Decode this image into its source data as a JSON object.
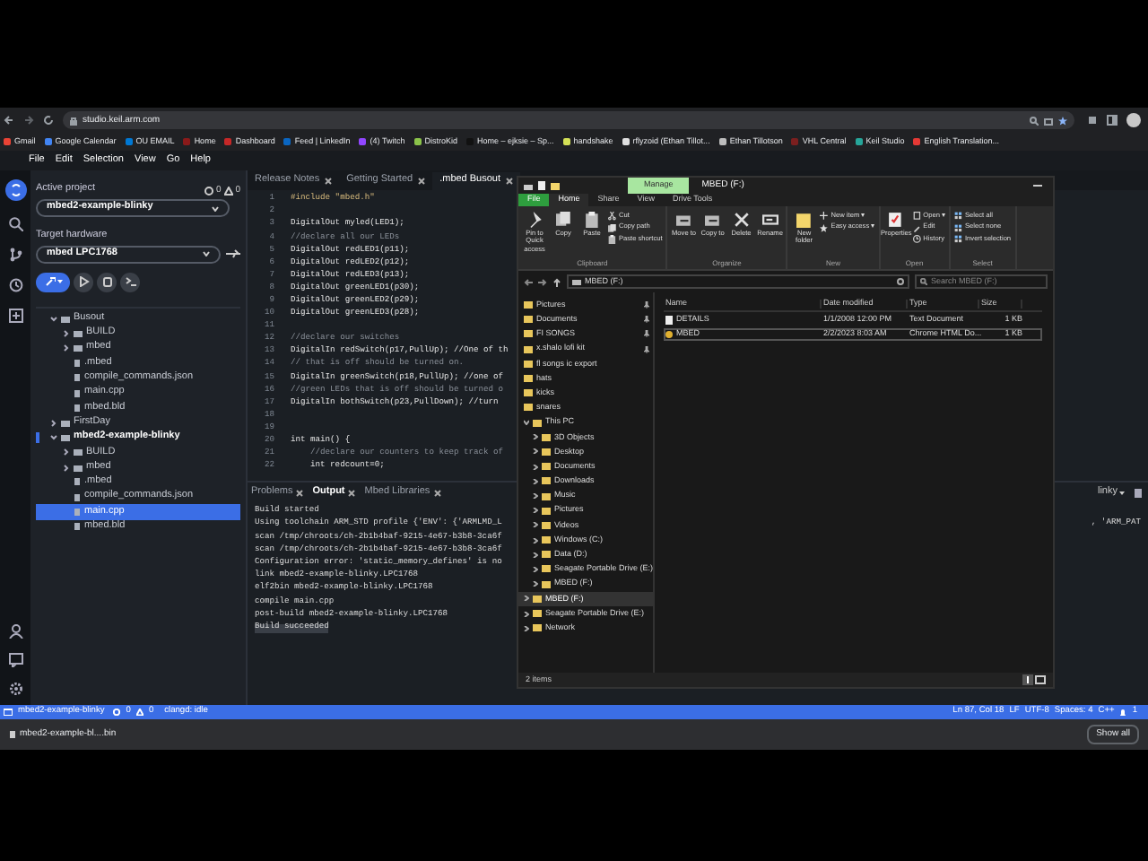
{
  "browser": {
    "url": "studio.keil.arm.com",
    "bookmarks": [
      {
        "label": "Gmail",
        "color": "#ea4335"
      },
      {
        "label": "Google Calendar",
        "color": "#4285f4"
      },
      {
        "label": "OU EMAIL",
        "color": "#0078d4"
      },
      {
        "label": "Home",
        "color": "#8b1a1a"
      },
      {
        "label": "Dashboard",
        "color": "#c62828"
      },
      {
        "label": "Feed | LinkedIn",
        "color": "#0a66c2"
      },
      {
        "label": "(4) Twitch",
        "color": "#9146ff"
      },
      {
        "label": "DistroKid",
        "color": "#8bc34a"
      },
      {
        "label": "Home – ejksie – Sp...",
        "color": "#111111"
      },
      {
        "label": "handshake",
        "color": "#d4e157"
      },
      {
        "label": "rflyzoid (Ethan Tillot...",
        "color": "#e0e0e0"
      },
      {
        "label": "Ethan Tillotson",
        "color": "#bdbdbd"
      },
      {
        "label": "VHL Central",
        "color": "#7b1f1f"
      },
      {
        "label": "Keil Studio",
        "color": "#26a69a"
      },
      {
        "label": "English Translation...",
        "color": "#e53935"
      }
    ]
  },
  "menu": [
    "File",
    "Edit",
    "Selection",
    "View",
    "Go",
    "Help"
  ],
  "sidebar": {
    "active_project_label": "Active project",
    "errors": "0",
    "warnings": "0",
    "active_project": "mbed2-example-blinky",
    "target_label": "Target hardware",
    "target": "mbed LPC1768",
    "tree": [
      {
        "label": "Busout",
        "kind": "folder",
        "expanded": true,
        "active": false,
        "selected": false,
        "children": [
          {
            "label": "BUILD",
            "kind": "folder",
            "expanded": false,
            "selected": false
          },
          {
            "label": "mbed",
            "kind": "folder",
            "expanded": false,
            "selected": false
          },
          {
            "label": ".mbed",
            "kind": "file",
            "selected": false
          },
          {
            "label": "compile_commands.json",
            "kind": "file",
            "selected": false
          },
          {
            "label": "main.cpp",
            "kind": "file",
            "selected": false
          },
          {
            "label": "mbed.bld",
            "kind": "file",
            "selected": false
          }
        ]
      },
      {
        "label": "FirstDay",
        "kind": "folder",
        "expanded": false,
        "active": false,
        "selected": false
      },
      {
        "label": "mbed2-example-blinky",
        "kind": "folder",
        "expanded": true,
        "active": true,
        "selected": false,
        "children": [
          {
            "label": "BUILD",
            "kind": "folder",
            "expanded": false,
            "selected": false
          },
          {
            "label": "mbed",
            "kind": "folder",
            "expanded": false,
            "selected": false
          },
          {
            "label": ".mbed",
            "kind": "file",
            "selected": false
          },
          {
            "label": "compile_commands.json",
            "kind": "file",
            "selected": false
          },
          {
            "label": "main.cpp",
            "kind": "file",
            "selected": true
          },
          {
            "label": "mbed.bld",
            "kind": "file",
            "selected": false
          }
        ]
      }
    ]
  },
  "editor": {
    "tabs": [
      {
        "label": "Release Notes",
        "selected": false
      },
      {
        "label": "Getting Started",
        "selected": false
      },
      {
        "label": ".mbed Busout",
        "selected": true
      }
    ],
    "lines": [
      {
        "number": "1",
        "kind": "include",
        "text": "#include \"mbed.h\""
      },
      {
        "number": "2"
      },
      {
        "number": "3",
        "kind": "code",
        "text": "DigitalOut myled(LED1);"
      },
      {
        "number": "4",
        "kind": "comment",
        "text": "//declare all our LEDs"
      },
      {
        "number": "5",
        "kind": "code",
        "text": "DigitalOut redLED1(p11);"
      },
      {
        "number": "6",
        "kind": "code",
        "text": "DigitalOut redLED2(p12);"
      },
      {
        "number": "7",
        "kind": "code",
        "text": "DigitalOut redLED3(p13);"
      },
      {
        "number": "8",
        "kind": "code",
        "text": "DigitalOut greenLED1(p30);"
      },
      {
        "number": "9",
        "kind": "code",
        "text": "DigitalOut greenLED2(p29);"
      },
      {
        "number": "10",
        "kind": "code",
        "text": "DigitalOut greenLED3(p28);"
      },
      {
        "number": "11"
      },
      {
        "number": "12",
        "kind": "comment",
        "text": "//declare our switches"
      },
      {
        "number": "13",
        "kind": "code",
        "text": "DigitalIn redSwitch(p17,PullUp); //One of th"
      },
      {
        "number": "14",
        "kind": "comment",
        "text": "// that is off should be turned on."
      },
      {
        "number": "15",
        "kind": "code",
        "text": "DigitalIn greenSwitch(p18,PullUp); //one of"
      },
      {
        "number": "16",
        "kind": "comment",
        "text": "//green LEDs that is off should be turned o"
      },
      {
        "number": "17",
        "kind": "code",
        "text": "DigitalIn bothSwitch(p23,PullDown); //turn"
      },
      {
        "number": "18"
      },
      {
        "number": "19"
      },
      {
        "number": "20",
        "kind": "code",
        "text": "int main() {"
      },
      {
        "number": "21",
        "kind": "comment",
        "text": "    //declare our counters to keep track of"
      },
      {
        "number": "22",
        "kind": "code",
        "text": "    int redcount=0;"
      }
    ]
  },
  "panel": {
    "tabs": [
      {
        "label": "Problems",
        "selected": false
      },
      {
        "label": "Output",
        "selected": true
      },
      {
        "label": "Mbed Libraries",
        "selected": false
      }
    ],
    "dropdown": "linky",
    "output": [
      {
        "text": "Build started",
        "highlighted": false
      },
      {
        "text": "Using toolchain ARM_STD profile {'ENV': {'ARMLMD_L",
        "tail": ", 'ARM_PAT",
        "highlighted": false
      },
      {
        "text": "scan /tmp/chroots/ch-2b1b4baf-9215-4e67-b3b8-3ca6f",
        "highlighted": false
      },
      {
        "text": "scan /tmp/chroots/ch-2b1b4baf-9215-4e67-b3b8-3ca6f",
        "highlighted": false
      },
      {
        "text": "Configuration error: 'static_memory_defines' is no",
        "highlighted": false
      },
      {
        "text": "link mbed2-example-blinky.LPC1768",
        "highlighted": false
      },
      {
        "text": "elf2bin mbed2-example-blinky.LPC1768",
        "highlighted": false
      },
      {
        "text": "compile main.cpp",
        "highlighted": false
      },
      {
        "text": "post-build mbed2-example-blinky.LPC1768",
        "highlighted": false
      },
      {
        "text": "Build succeeded",
        "highlighted": true
      }
    ]
  },
  "status_bar": {
    "project": "mbed2-example-blinky",
    "errors": "0",
    "warnings": "0",
    "language_server": "clangd: idle",
    "position": "Ln 87, Col 18",
    "eol": "LF",
    "encoding": "UTF-8",
    "indent": "Spaces: 4",
    "language": "C++",
    "notifications": "1"
  },
  "downloads": {
    "file": "mbed2-example-bl....bin",
    "show_all": "Show all"
  },
  "explorer": {
    "title": "MBED (F:)",
    "context_tab": "Manage",
    "tabs": [
      {
        "label": "File",
        "kind": "menu",
        "selected": false
      },
      {
        "label": "Home",
        "kind": "tab",
        "selected": true
      },
      {
        "label": "Share",
        "kind": "tab",
        "selected": false
      },
      {
        "label": "View",
        "kind": "tab",
        "selected": false
      },
      {
        "label": "Drive Tools",
        "kind": "tab",
        "selected": false
      }
    ],
    "ribbon": [
      {
        "group": "Clipboard",
        "large": [
          "Pin to Quick access",
          "Copy",
          "Paste"
        ],
        "small": [
          "Cut",
          "Copy path",
          "Paste shortcut"
        ]
      },
      {
        "group": "Organize",
        "large": [
          "Move to",
          "Copy to",
          "Delete",
          "Rename"
        ]
      },
      {
        "group": "New",
        "large": [
          "New folder"
        ],
        "small": [
          "New item ▾",
          "Easy access ▾"
        ]
      },
      {
        "group": "Open",
        "large": [
          "Properties"
        ],
        "small": [
          "Open ▾",
          "Edit",
          "History"
        ]
      },
      {
        "group": "Select",
        "small": [
          "Select all",
          "Select none",
          "Invert selection"
        ]
      }
    ],
    "address": "MBED (F:)",
    "search_placeholder": "Search MBED (F:)",
    "nav": [
      {
        "label": "Pictures",
        "pinned": true,
        "selected": false
      },
      {
        "label": "Documents",
        "pinned": true,
        "selected": false
      },
      {
        "label": "FI SONGS",
        "pinned": true,
        "selected": false
      },
      {
        "label": "x.shalo lofi kit",
        "pinned": true,
        "selected": false
      },
      {
        "label": "fl songs ic export",
        "pinned": false,
        "selected": false
      },
      {
        "label": "hats",
        "pinned": false,
        "selected": false
      },
      {
        "label": "kicks",
        "pinned": false,
        "selected": false
      },
      {
        "label": "snares",
        "pinned": false,
        "selected": false
      },
      {
        "label": "This PC",
        "expanded": true,
        "selected": false,
        "children": [
          {
            "label": "3D Objects",
            "selected": false
          },
          {
            "label": "Desktop",
            "selected": false
          },
          {
            "label": "Documents",
            "selected": false
          },
          {
            "label": "Downloads",
            "selected": false
          },
          {
            "label": "Music",
            "selected": false
          },
          {
            "label": "Pictures",
            "selected": false
          },
          {
            "label": "Videos",
            "selected": false
          },
          {
            "label": "Windows (C:)",
            "selected": false
          },
          {
            "label": "Data (D:)",
            "selected": false
          },
          {
            "label": "Seagate Portable Drive (E:)",
            "selected": false
          },
          {
            "label": "MBED (F:)",
            "selected": false
          }
        ]
      },
      {
        "label": "MBED (F:)",
        "expanded": false,
        "selected": true
      },
      {
        "label": "Seagate Portable Drive (E:)",
        "expanded": false,
        "selected": false
      },
      {
        "label": "Network",
        "expanded": false,
        "selected": false
      }
    ],
    "columns": [
      "Name",
      "Date modified",
      "Type",
      "Size"
    ],
    "files": [
      {
        "name": "DETAILS",
        "date": "1/1/2008 12:00 PM",
        "type": "Text Document",
        "size": "1 KB",
        "selected": false
      },
      {
        "name": "MBED",
        "date": "2/2/2023 8:03 AM",
        "type": "Chrome HTML Do...",
        "size": "1 KB",
        "selected": true
      }
    ],
    "status": "2 items"
  }
}
